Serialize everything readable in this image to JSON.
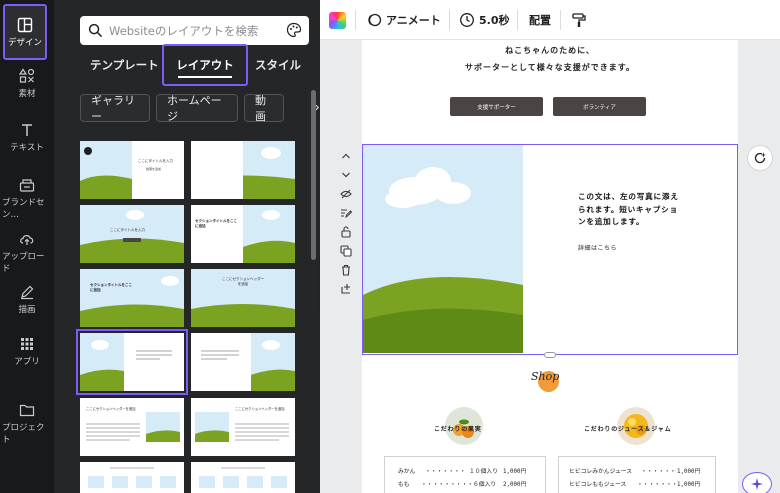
{
  "rail": {
    "items": [
      {
        "label": "デザイン"
      },
      {
        "label": "素材"
      },
      {
        "label": "テキスト"
      },
      {
        "label": "ブランドセン…"
      },
      {
        "label": "アップロード"
      },
      {
        "label": "描画"
      },
      {
        "label": "アプリ"
      },
      {
        "label": "プロジェクト"
      }
    ]
  },
  "panel": {
    "search_placeholder": "Websiteのレイアウトを検索",
    "tabs": [
      {
        "label": "テンプレート"
      },
      {
        "label": "レイアウト"
      },
      {
        "label": "スタイル"
      }
    ],
    "chips": [
      {
        "label": "ギャラリー"
      },
      {
        "label": "ホームページ"
      },
      {
        "label": "動画"
      }
    ],
    "thumbs": {
      "t1_title": "ここにタイトルを入力",
      "t1_sub": "説明を追加",
      "t3_title": "ここにタイトルを入力",
      "t4_title": "セクションタイトルをここに追加",
      "t5_title": "セクションタイトルをここに追加",
      "t6_title": "ここにセクションヘッダーを追加",
      "t9_title": "ここにセクションヘッダーを追加",
      "t10_title": "ここにセクションヘッダーを追加"
    }
  },
  "toolbar": {
    "animate": "アニメート",
    "duration": "5.0秒",
    "position": "配置"
  },
  "page": {
    "intro_line1": "ねこちゃんのために、",
    "intro_line2": "サポーターとして様々な支援ができます。",
    "btn_supporter": "支援サポーター",
    "btn_volunteer": "ボランティア",
    "caption_line1": "この文は、左の写真に添え",
    "caption_line2": "られます。短いキャプショ",
    "caption_line3": "ンを追加します。",
    "details_link": "詳細はこちら",
    "shop_logo": "Shop",
    "heading_fruit": "こだわりの果実",
    "heading_juice": "こだわりのジュース＆ジャム",
    "fruit_rows": [
      {
        "name": "みかん",
        "qty": "１０個入り",
        "price": "1,000円"
      },
      {
        "name": "もも",
        "qty": "６個入り",
        "price": "2,000円"
      }
    ],
    "juice_rows": [
      {
        "name": "ヒビコレみかんジュース",
        "price": "1,000円"
      },
      {
        "name": "ヒビコレももジュース",
        "price": "1,000円"
      }
    ]
  },
  "colors": {
    "accent": "#7d5cf5",
    "sky": "#d5ebf7",
    "grass": "#7ba321",
    "grass_dark": "#5f8a16",
    "button": "#4a4442"
  }
}
